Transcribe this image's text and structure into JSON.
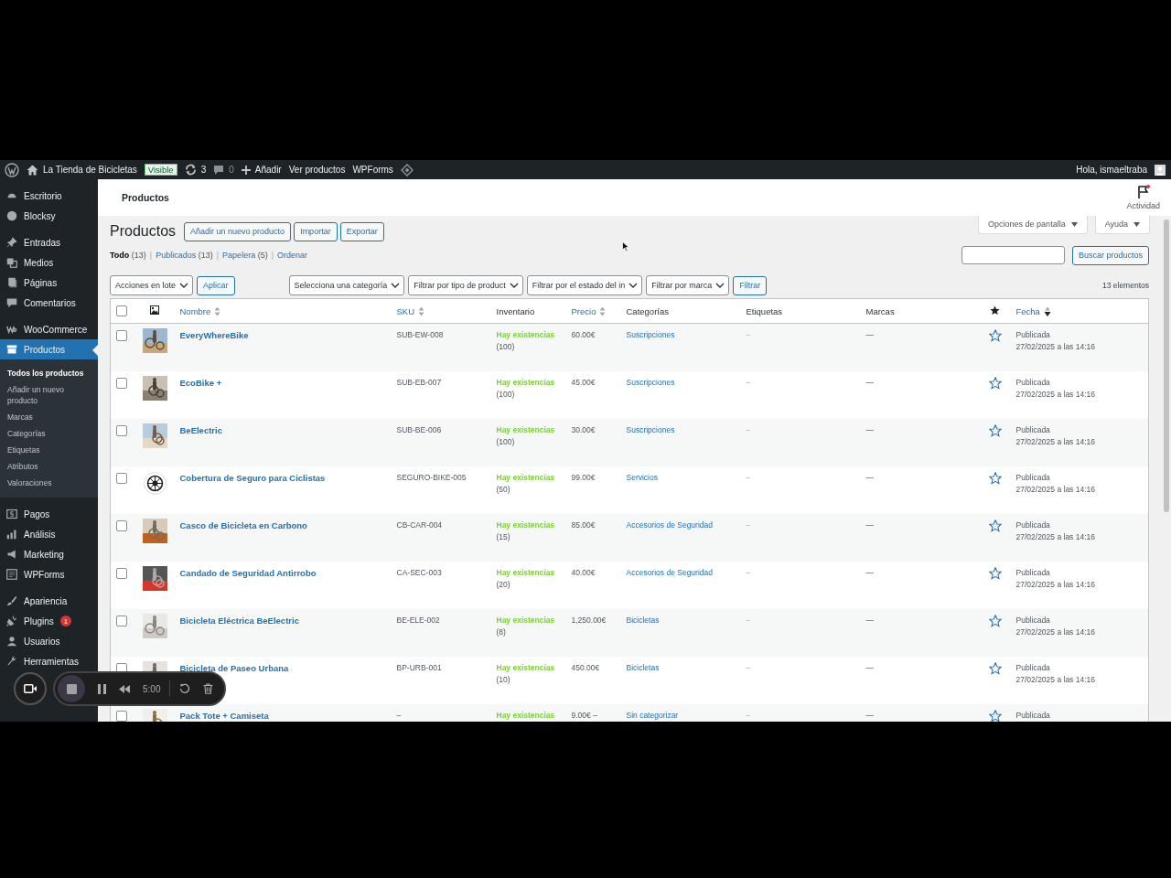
{
  "admin_bar": {
    "site": "La Tienda de Bicicletas",
    "visibility": "Visible",
    "updates": "3",
    "comments": "0",
    "new": "Añadir",
    "links": [
      "Ver productos",
      "WPForms"
    ],
    "greeting": "Hola, ismaeltraba"
  },
  "sidebar": {
    "groups": [
      [
        {
          "label": "Escritorio",
          "selected": false
        },
        {
          "label": "Blocksy",
          "selected": false
        }
      ],
      [
        {
          "label": "Entradas",
          "selected": false
        },
        {
          "label": "Medios",
          "selected": false
        },
        {
          "label": "Páginas",
          "selected": false
        },
        {
          "label": "Comentarios",
          "selected": false
        }
      ],
      [
        {
          "label": "WooCommerce",
          "selected": false
        },
        {
          "label": "Productos",
          "selected": true,
          "children": [
            {
              "label": "Todos los productos",
              "selected": true
            },
            {
              "label": "Añadir un nuevo producto",
              "selected": false
            },
            {
              "label": "Marcas",
              "selected": false
            },
            {
              "label": "Categorías",
              "selected": false
            },
            {
              "label": "Etiquetas",
              "selected": false
            },
            {
              "label": "Atributos",
              "selected": false
            },
            {
              "label": "Valoraciones",
              "selected": false
            }
          ]
        }
      ],
      [
        {
          "label": "Pagos",
          "selected": false
        },
        {
          "label": "Análisis",
          "selected": false
        },
        {
          "label": "Marketing",
          "selected": false
        },
        {
          "label": "WPForms",
          "selected": false
        }
      ],
      [
        {
          "label": "Apariencia",
          "selected": false
        },
        {
          "label": "Plugins",
          "selected": false,
          "badge": "1"
        },
        {
          "label": "Usuarios",
          "selected": false
        },
        {
          "label": "Herramientas",
          "selected": false
        }
      ]
    ]
  },
  "header": {
    "title": "Productos",
    "activity": "Actividad"
  },
  "screen_tabs": [
    "Opciones de pantalla",
    "Ayuda"
  ],
  "page": {
    "title": "Productos",
    "buttons": [
      "Añadir un nuevo producto",
      "Importar",
      "Exportar"
    ]
  },
  "views": {
    "separator": "|",
    "items": [
      {
        "label": "Todo",
        "count": "(13)",
        "selected": true
      },
      {
        "label": "Publicados",
        "count": "(13)",
        "selected": false
      },
      {
        "label": "Papelera",
        "count": "(5)",
        "selected": false
      },
      {
        "label": "Ordenar",
        "selected": false
      }
    ]
  },
  "search": {
    "button": "Buscar productos"
  },
  "filters": {
    "bulk": "Acciones en lote",
    "apply": "Aplicar",
    "selects": [
      "Selecciona una categoría",
      "Filtrar por tipo de product",
      "Filtrar por el estado del in",
      "Filtrar por marca"
    ],
    "filter": "Filtrar",
    "count": "13 elementos"
  },
  "table": {
    "select_all": {
      "checked": false
    },
    "columns": [
      {
        "label": "Nombre",
        "sortable": true,
        "sorted": false
      },
      {
        "label": "SKU",
        "sortable": true,
        "sorted": false
      },
      {
        "label": "Inventario",
        "sortable": false
      },
      {
        "label": "Precio",
        "sortable": true,
        "sorted": false
      },
      {
        "label": "Categorías",
        "sortable": false
      },
      {
        "label": "Etiquetas",
        "sortable": false
      },
      {
        "label": "Marcas",
        "sortable": false
      },
      {
        "label": "Fecha",
        "sortable": true,
        "sorted": true
      }
    ],
    "rows": [
      {
        "checked": false,
        "name": "EveryWhereBike",
        "sku": "SUB-EW-008",
        "stock": "Hay existencias",
        "stock_count": "(100)",
        "price": "60.00€",
        "category": "Suscripciones",
        "tags": "–",
        "brand": "—",
        "featured": false,
        "status": "Publicada",
        "date": "27/02/2025 a las 14:16"
      },
      {
        "checked": false,
        "name": "EcoBike +",
        "sku": "SUB-EB-007",
        "stock": "Hay existencias",
        "stock_count": "(100)",
        "price": "45.00€",
        "category": "Suscripciones",
        "tags": "–",
        "brand": "—",
        "featured": false,
        "status": "Publicada",
        "date": "27/02/2025 a las 14:16"
      },
      {
        "checked": false,
        "name": "BeElectric",
        "sku": "SUB-BE-006",
        "stock": "Hay existencias",
        "stock_count": "(100)",
        "price": "30.00€",
        "category": "Suscripciones",
        "tags": "–",
        "brand": "—",
        "featured": false,
        "status": "Publicada",
        "date": "27/02/2025 a las 14:16"
      },
      {
        "checked": false,
        "thumb": {
          "kind": "emblem"
        },
        "name": "Cobertura de Seguro para Ciclistas",
        "sku": "SEGURO-BIKE-005",
        "stock": "Hay existencias",
        "stock_count": "(50)",
        "price": "99.00€",
        "category": "Servicios",
        "tags": "–",
        "brand": "—",
        "featured": false,
        "status": "Publicada",
        "date": "27/02/2025 a las 14:16"
      },
      {
        "checked": false,
        "name": "Casco de Bicicleta en Carbono",
        "sku": "CB-CAR-004",
        "stock": "Hay existencias",
        "stock_count": "(15)",
        "price": "85.00€",
        "category": "Accesorios de Seguridad",
        "tags": "–",
        "brand": "—",
        "featured": false,
        "status": "Publicada",
        "date": "27/02/2025 a las 14:16"
      },
      {
        "checked": false,
        "name": "Candado de Seguridad Antirrobo",
        "sku": "CA-SEC-003",
        "stock": "Hay existencias",
        "stock_count": "(20)",
        "price": "40.00€",
        "category": "Accesorios de Seguridad",
        "tags": "–",
        "brand": "—",
        "featured": false,
        "status": "Publicada",
        "date": "27/02/2025 a las 14:16"
      },
      {
        "checked": false,
        "name": "Bicicleta Eléctrica BeElectric",
        "sku": "BE-ELE-002",
        "stock": "Hay existencias",
        "stock_count": "(8)",
        "price": "1,250.00€",
        "category": "Bicicletas",
        "tags": "–",
        "brand": "—",
        "featured": false,
        "status": "Publicada",
        "date": "27/02/2025 a las 14:16"
      },
      {
        "checked": false,
        "name": "Bicicleta de Paseo Urbana",
        "sku": "BP-URB-001",
        "stock": "Hay existencias",
        "stock_count": "(10)",
        "price": "450.00€",
        "category": "Bicicletas",
        "tags": "–",
        "brand": "—",
        "featured": false,
        "status": "Publicada",
        "date": "27/02/2025 a las 14:16"
      },
      {
        "checked": false,
        "name": "Pack Tote + Camiseta",
        "sku": "–",
        "stock": "Hay existencias",
        "price": "9.00€ –",
        "category": "Sin categorizar",
        "tags": "–",
        "brand": "—",
        "featured": false,
        "status": "Publicada"
      }
    ]
  },
  "recorder": {
    "time": "5:00"
  }
}
